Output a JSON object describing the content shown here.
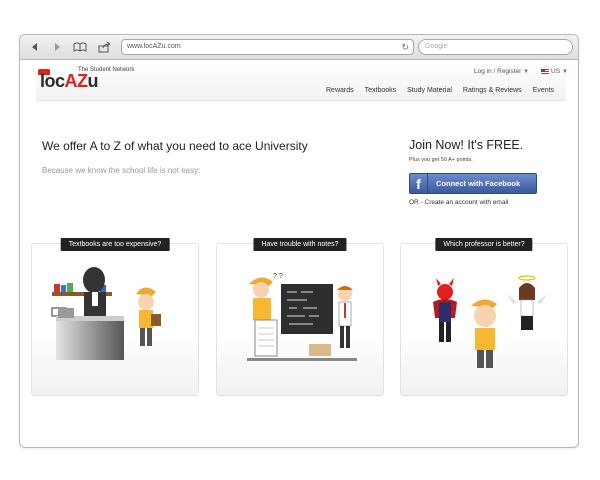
{
  "browser": {
    "url": "www.locAZu.com",
    "search_placeholder": "Google"
  },
  "header": {
    "tagline": "The Student Network",
    "logo": {
      "part1": "loc",
      "part2": "AZ",
      "part3": "u"
    },
    "login_label": "Log in / Register",
    "language": "US",
    "nav": [
      "Rewards",
      "Textbooks",
      "Study Material",
      "Ratings & Reviews",
      "Events"
    ]
  },
  "hero": {
    "title": "We offer A to Z of what you need to ace University",
    "subtitle": "Because we know the school life is not easy:"
  },
  "join": {
    "title": "Join Now! It's FREE.",
    "subtitle": "Plus you get 50 A+ points.",
    "facebook_button": {
      "prefix": "Connect with ",
      "brand": "Facebook"
    },
    "alt_link": "OR - Create an account with email"
  },
  "cards": [
    {
      "label": "Textbooks are too expensive?"
    },
    {
      "label": "Have trouble with notes?"
    },
    {
      "label": "Which professor is better?"
    }
  ],
  "colors": {
    "brand_red": "#e01f1f",
    "facebook_blue": "#3b5a9d",
    "text_dark": "#222222",
    "text_muted": "#999999"
  }
}
